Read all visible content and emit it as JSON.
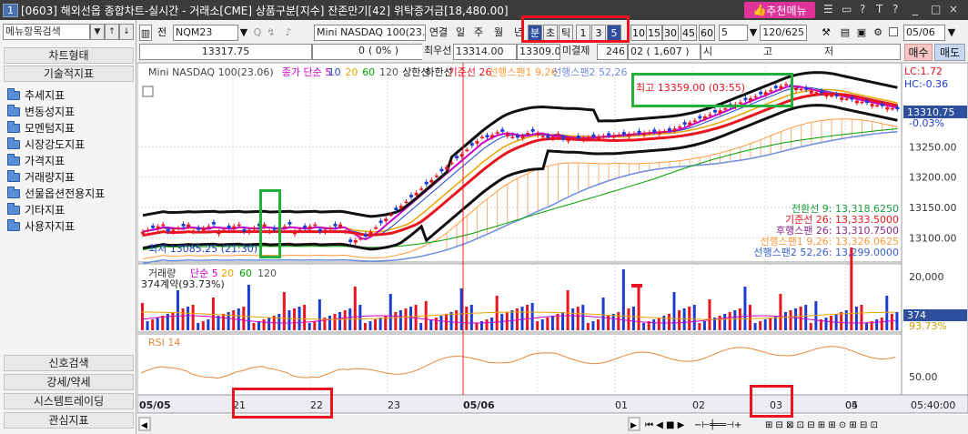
{
  "window": {
    "number": "1",
    "title": "[0603] 해외선옵 종합차트-실시간 - 거래소[CME] 상품구분[지수] 잔존만기[42] 위탁증거금[18,480.00]",
    "recommend": "추천메뉴",
    "controls": [
      "☰",
      "▭",
      "?",
      "T",
      "?",
      "_",
      "□",
      "×"
    ]
  },
  "left": {
    "search_placeholder": "메뉴항목검색",
    "top_header": "차트형태",
    "section_header": "기술적지표",
    "items": [
      "추세지표",
      "변동성지표",
      "모멘텀지표",
      "시장강도지표",
      "가격지표",
      "거래량지표",
      "선물옵션전용지표",
      "기타지표",
      "사용자지표"
    ],
    "bottom": [
      "신호검색",
      "강세/약세",
      "시스템트레이딩",
      "관심지표"
    ]
  },
  "toolbar": {
    "jeon": "전",
    "code": "NQM23",
    "name": "Mini NASDAQ 100(23.0",
    "modes": [
      "연결",
      "일",
      "주",
      "월",
      "년"
    ],
    "period_units": [
      "분",
      "초",
      "틱"
    ],
    "minutes": [
      "1",
      "3",
      "5",
      "10",
      "15",
      "30",
      "45",
      "60"
    ],
    "active_minute": "5",
    "count_sel": "5",
    "range": "120/625",
    "checkbox_label": "",
    "date": "05/06",
    "price": "13317.75",
    "pct": "0%",
    "chg": "0",
    "chg_pct": "( 0% )",
    "best_label": "최우선",
    "best": "13314.00",
    "bid": "13309.00",
    "open_int_label": "미결제",
    "open_int": "246",
    "vol": "02 ( 1,607 )",
    "labels2": [
      "시",
      "고",
      "저"
    ],
    "sell": "매수",
    "buy": "매도"
  },
  "chart": {
    "legend": [
      "Mini NASDAQ 100(23.06)",
      "종가 단순 5",
      "10",
      "20",
      "60",
      "120",
      "상한선",
      "하한선",
      "기준선 26",
      "선행스팬1 9,26",
      "선행스팬2 52,26"
    ],
    "legend_colors": [
      "#444",
      "#cc00cc",
      "#1a44c8",
      "#e8a400",
      "#00a000",
      "#555",
      "#111",
      "#111",
      "#e8141e",
      "#ff9a3c",
      "#6e8ce0"
    ],
    "high_label": "최고 13359.00 (03:55)",
    "low_label": "최저 13085.25 (21:30)",
    "lc": "LC:1.72",
    "hc": "HC:-0.36",
    "cur_price": "13310.75",
    "cur_pct": "-0.03%",
    "ticks": [
      "13250.00",
      "13200.00",
      "13150.00",
      "13100.00"
    ],
    "ichi": [
      {
        "t": "전환선 9: 13,318.6250",
        "c": "#1a9a3a"
      },
      {
        "t": "기준선 26: 13,333.5000",
        "c": "#e8141e"
      },
      {
        "t": "후행스팬 26: 13,310.7500",
        "c": "#8a2a8a"
      },
      {
        "t": "선행스팬1 9,26: 13,326.0625",
        "c": "#ff9a3c"
      },
      {
        "t": "선행스팬2 52,26: 13,299.0000",
        "c": "#3a62d0"
      }
    ]
  },
  "volume": {
    "legend": [
      "거래량",
      "단순 5",
      "20",
      "60",
      "120"
    ],
    "legend_colors": [
      "#333",
      "#cc00cc",
      "#e8a400",
      "#00a000",
      "#555"
    ],
    "contract": "374계약(93.73%)",
    "ticks": [
      "20,000"
    ],
    "cur": "374",
    "cur_pct": "93.73%"
  },
  "rsi": {
    "label": "RSI 14",
    "tick": "50.00"
  },
  "xaxis": {
    "labels": [
      "05/05",
      "21",
      "22",
      "23",
      "05/06",
      "01",
      "02",
      "03",
      "04",
      "05"
    ],
    "time": "05:40:00"
  },
  "chart_data": {
    "type": "candlestick",
    "title": "Mini NASDAQ 100(23.06)",
    "high": 13359.0,
    "high_time": "03:55",
    "low": 13085.25,
    "low_time": "21:30",
    "last": 13310.75,
    "ylim": [
      13075,
      13375
    ]
  }
}
